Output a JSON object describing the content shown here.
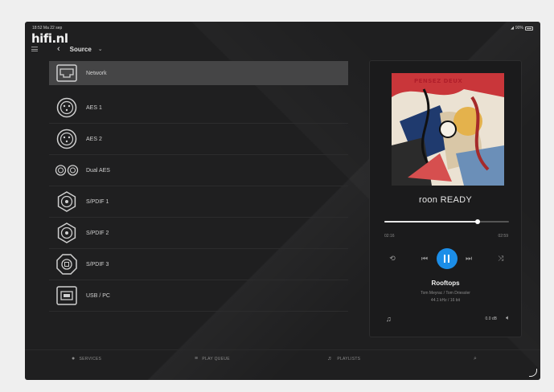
{
  "status": {
    "time": "18:52",
    "date": "Ma 22 sep",
    "battery": "90%"
  },
  "brand": {
    "logo": "hifi.nl"
  },
  "header": {
    "title": "Source"
  },
  "sources": [
    {
      "label": "Network",
      "icon": "ethernet-port-icon",
      "active": true
    },
    {
      "label": "AES 1",
      "icon": "xlr-connector-icon",
      "active": false
    },
    {
      "label": "AES 2",
      "icon": "xlr-connector-icon",
      "active": false
    },
    {
      "label": "Dual AES",
      "icon": "dual-xlr-icon",
      "active": false
    },
    {
      "label": "S/PDIF 1",
      "icon": "coax-connector-icon",
      "active": false
    },
    {
      "label": "S/PDIF 2",
      "icon": "coax-connector-icon",
      "active": false
    },
    {
      "label": "S/PDIF 3",
      "icon": "optical-connector-icon",
      "active": false
    },
    {
      "label": "USB / PC",
      "icon": "usb-b-port-icon",
      "active": false
    }
  ],
  "player": {
    "album_text": "PENSEZ DEUX",
    "brand": "roon READY",
    "progress": 0.75,
    "elapsed": "02:16",
    "total": "02:59",
    "track_title": "Rooftops",
    "artist": "Tom Meyrac / Tom Driessler",
    "format": "44.1 kHz / 16 bit",
    "volume": "0.0 dB"
  },
  "bottom_nav": {
    "services": "SERVICES",
    "play_queue": "PLAY QUEUE",
    "playlists": "PLAYLISTS"
  },
  "colors": {
    "accent": "#1c8ee8",
    "background": "#1f1f20",
    "active_row": "#454546"
  }
}
